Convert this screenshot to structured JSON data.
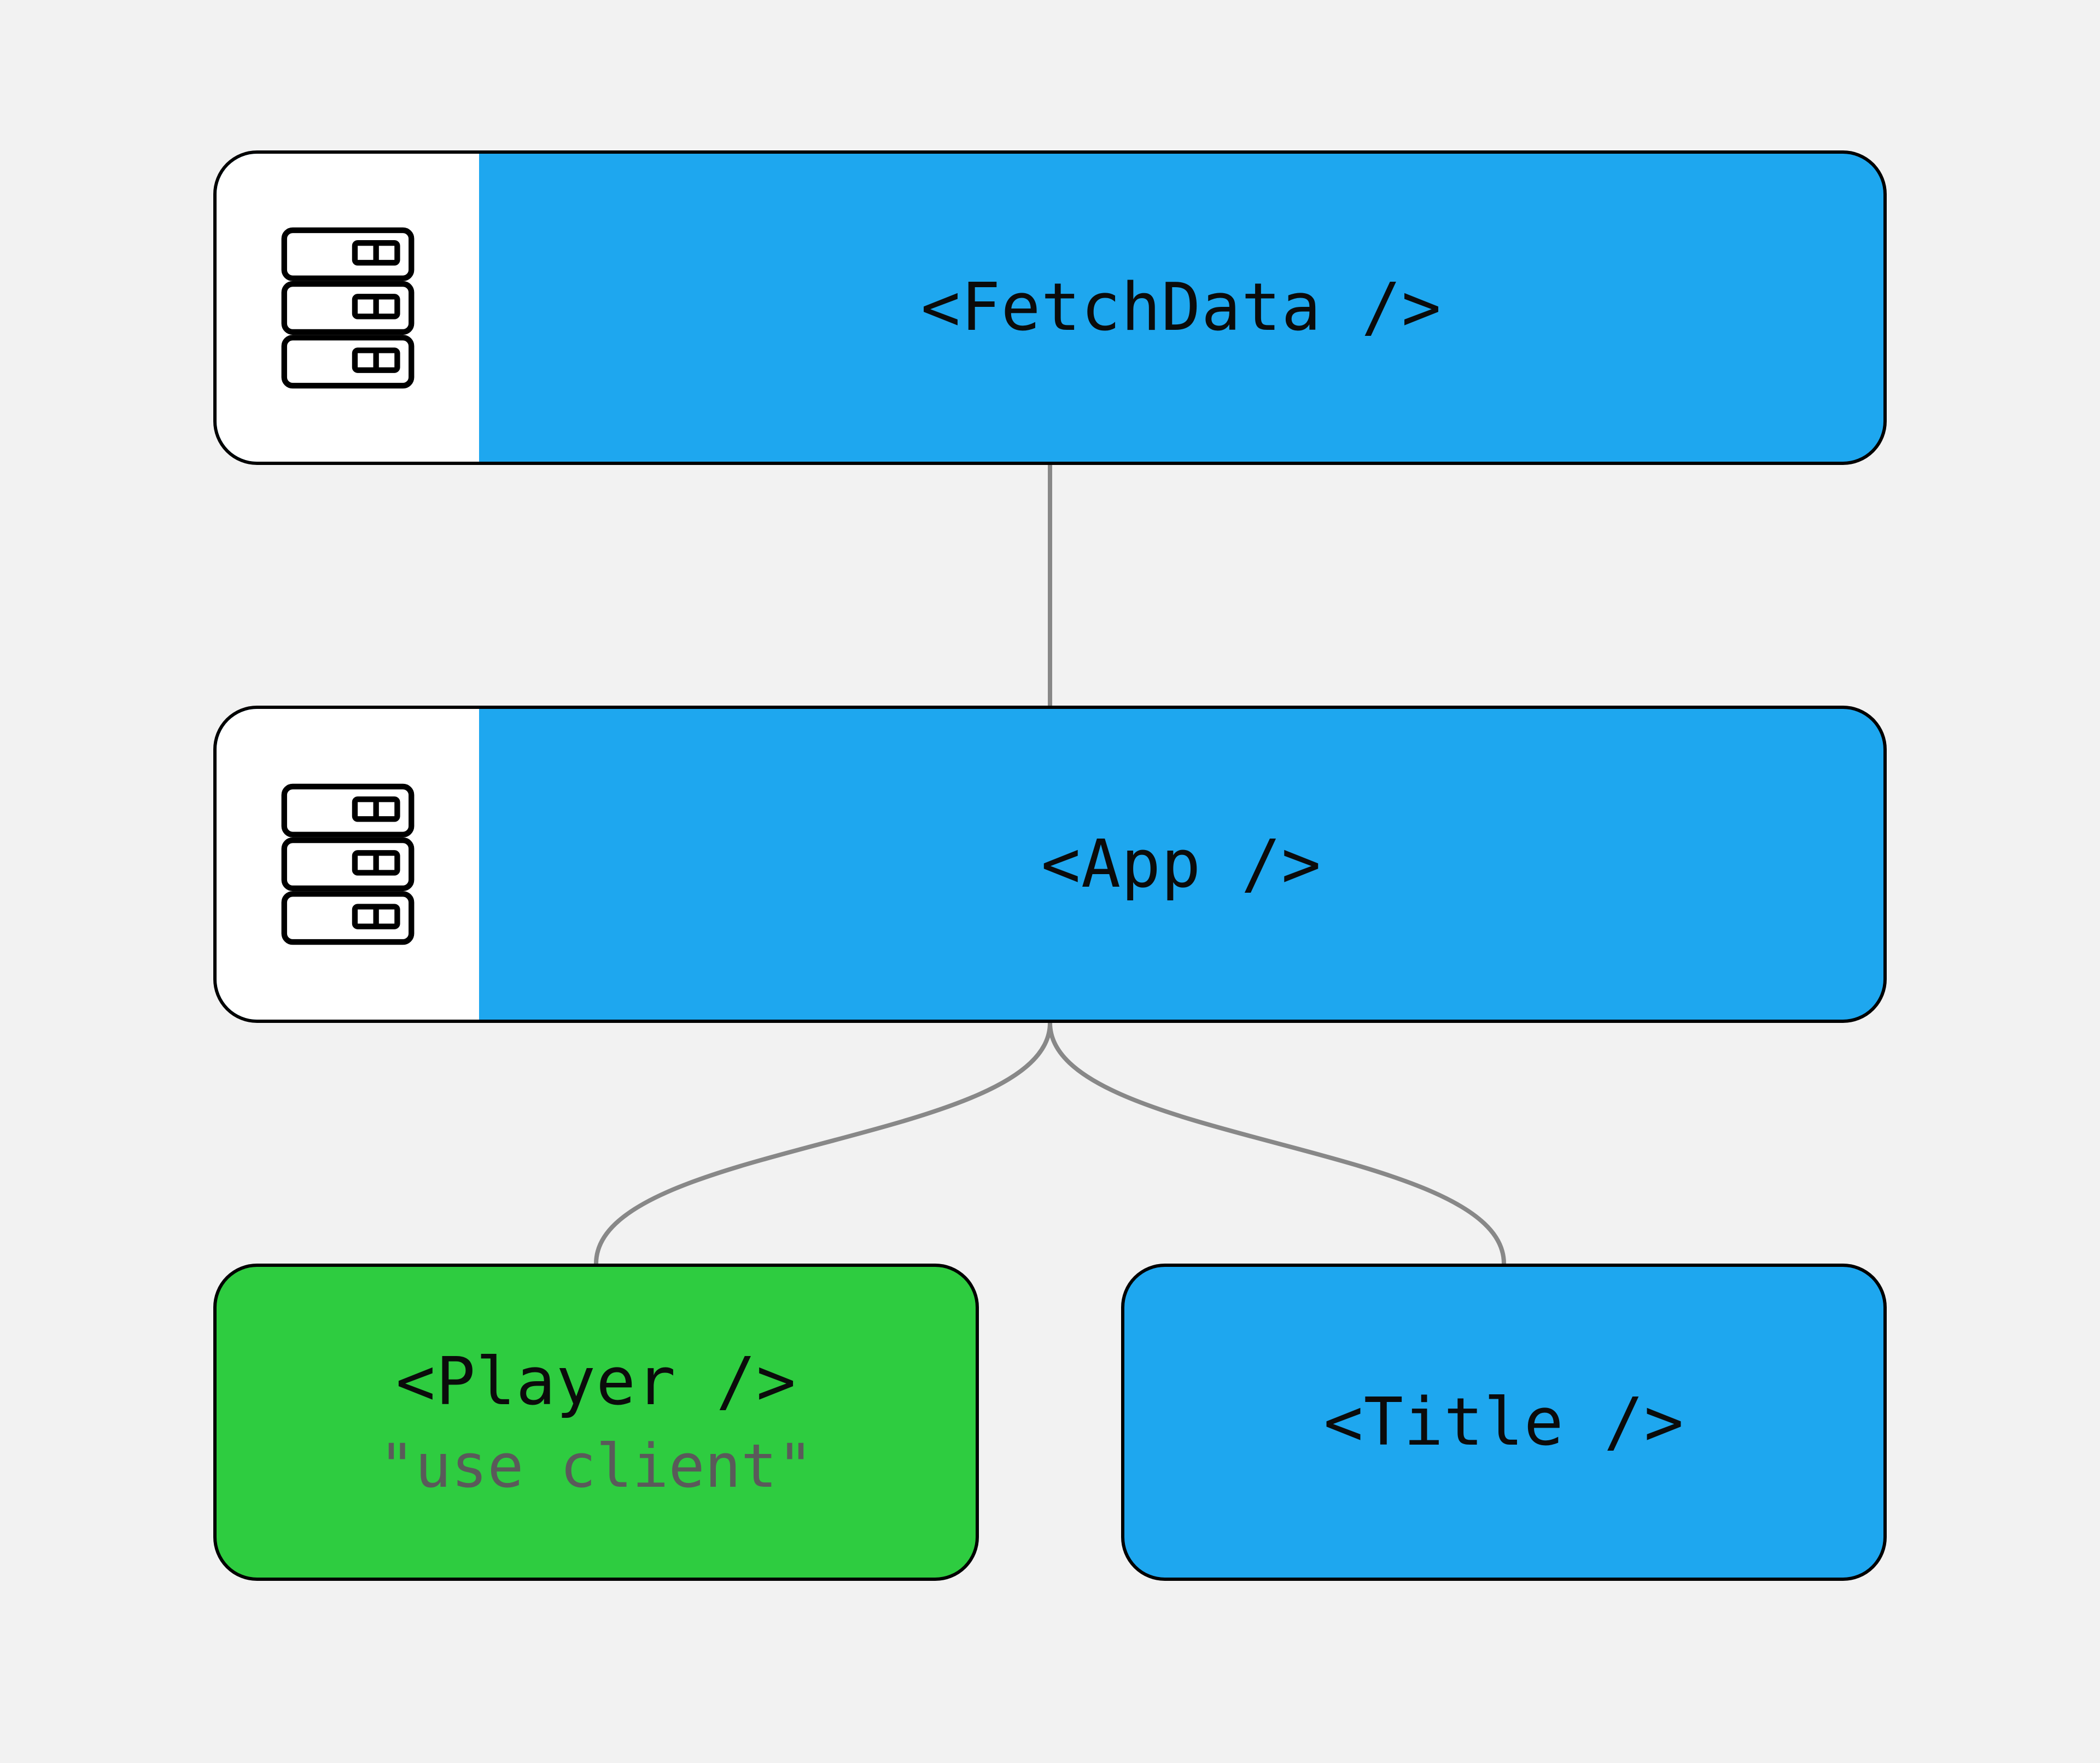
{
  "nodes": {
    "fetchdata": {
      "label": "<FetchData />",
      "type": "server"
    },
    "app": {
      "label": "<App />",
      "type": "server"
    },
    "player": {
      "label": "<Player />",
      "directive": "\"use client\"",
      "type": "client"
    },
    "title": {
      "label": "<Title />",
      "type": "server"
    }
  },
  "edges": [
    [
      "fetchdata",
      "app"
    ],
    [
      "app",
      "player"
    ],
    [
      "app",
      "title"
    ]
  ],
  "colors": {
    "server": "#1ea7ef",
    "client": "#2ecc40",
    "background": "#f2f2f2",
    "border": "#000000",
    "connector": "#888888"
  },
  "icons": {
    "server": "server-icon"
  }
}
